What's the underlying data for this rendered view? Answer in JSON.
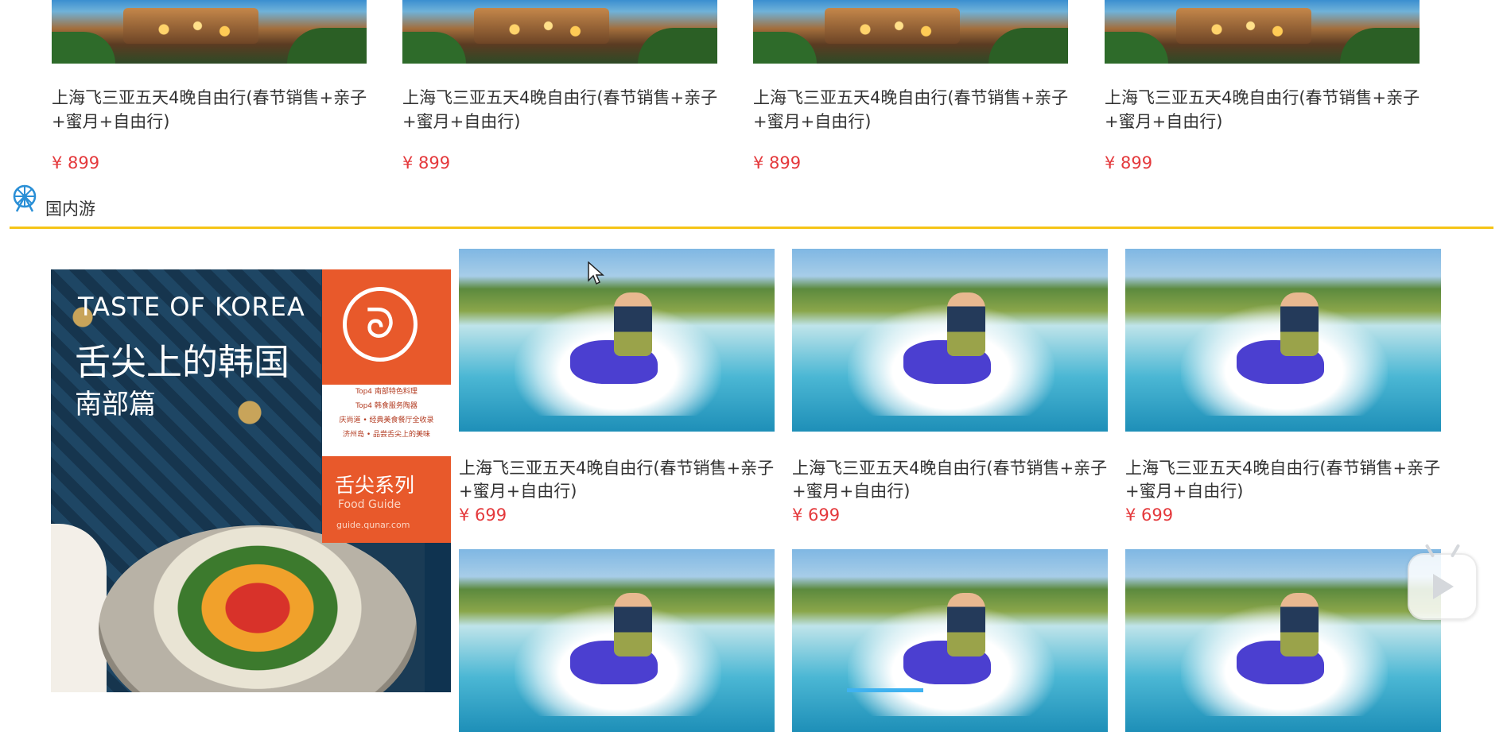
{
  "top_row": {
    "items": [
      {
        "title": "上海飞三亚五天4晚自由行(春节销售+亲子+蜜月+自由行)",
        "price": "¥ 899"
      },
      {
        "title": "上海飞三亚五天4晚自由行(春节销售+亲子+蜜月+自由行)",
        "price": "¥ 899"
      },
      {
        "title": "上海飞三亚五天4晚自由行(春节销售+亲子+蜜月+自由行)",
        "price": "¥ 899"
      },
      {
        "title": "上海飞三亚五天4晚自由行(春节销售+亲子+蜜月+自由行)",
        "price": "¥ 899"
      }
    ]
  },
  "section": {
    "title": "国内游",
    "icon": "ferris-wheel-icon",
    "accent_color": "#f5c417"
  },
  "banner": {
    "en_title": "TASTE OF KOREA",
    "cn_title": "舌尖上的韩国",
    "cn_subtitle": "南部篇",
    "list": [
      "Top4 南部特色料理",
      "Top4 韩食服务陶器",
      "庆尚道 • 经典美食餐厅全收录",
      "济州岛 • 品尝舌尖上的美味"
    ],
    "series": "舌尖系列",
    "series_en": "Food Guide",
    "url": "guide.qunar.com"
  },
  "products": {
    "row1": [
      {
        "title": "上海飞三亚五天4晚自由行(春节销售+亲子+蜜月+自由行)",
        "price": "¥ 699"
      },
      {
        "title": "上海飞三亚五天4晚自由行(春节销售+亲子+蜜月+自由行)",
        "price": "¥ 699"
      },
      {
        "title": "上海飞三亚五天4晚自由行(春节销售+亲子+蜜月+自由行)",
        "price": "¥ 699"
      }
    ]
  },
  "colors": {
    "price": "#e4393c",
    "text": "#333333"
  }
}
